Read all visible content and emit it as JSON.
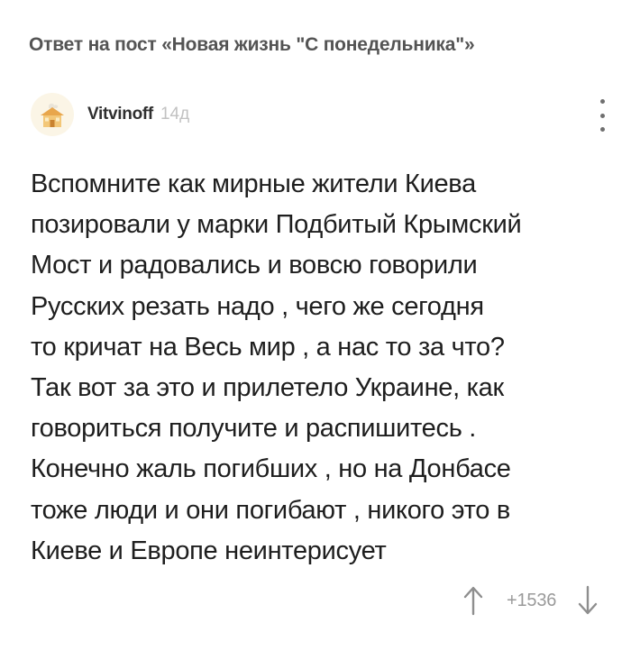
{
  "post": {
    "reply_to": "Ответ на пост «Новая жизнь \"С понедельника\"»"
  },
  "comment": {
    "author": "Vitvinoff",
    "time_ago": "14д",
    "avatar_icon": "house-avatar-icon",
    "lines": [
      "Вспомните как мирные жители Киева",
      "позировали у марки Подбитый Крымский",
      "Мост и радовались и вовсю говорили",
      "Русских резать надо , чего же сегодня",
      "то кричат на Весь мир , а нас то за что?",
      "Так вот за это и прилетело Украине, как",
      "говориться получите и распишитесь .",
      "Конечно жаль погибших , но на Донбасе",
      "тоже люди и они погибают , никого это в",
      "Киеве и Европе неинтерисует"
    ]
  },
  "rating": {
    "value": "+1536",
    "upvote_icon": "arrow-up-icon",
    "downvote_icon": "arrow-down-icon",
    "menu_icon": "more-vertical-icon"
  },
  "colors": {
    "background": "#ffffff",
    "header_text": "#545454",
    "body_text": "#1e1e1e",
    "muted": "#9a9a9a",
    "timestamp": "#c2c2c2"
  }
}
